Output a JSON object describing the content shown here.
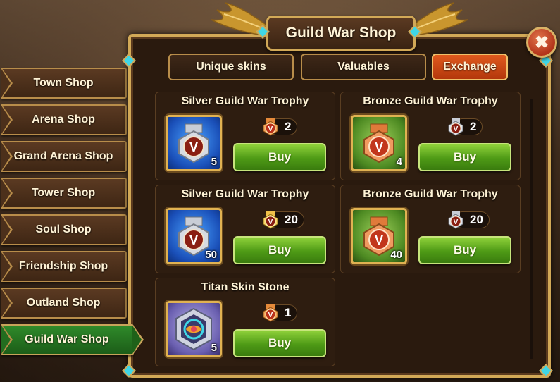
{
  "title": "Guild War Shop",
  "close_label": "✖",
  "side_tabs": [
    {
      "label": "Town Shop"
    },
    {
      "label": "Arena Shop"
    },
    {
      "label": "Grand Arena Shop"
    },
    {
      "label": "Tower Shop"
    },
    {
      "label": "Soul Shop"
    },
    {
      "label": "Friendship Shop"
    },
    {
      "label": "Outland Shop"
    },
    {
      "label": "Guild War Shop",
      "active": true
    }
  ],
  "top_tabs": [
    {
      "label": "Unique skins"
    },
    {
      "label": "Valuables"
    },
    {
      "label": "Exchange",
      "active": true
    }
  ],
  "items": [
    {
      "name": "Silver Guild War Trophy",
      "quantity": "5",
      "price": "2",
      "buy_label": "Buy",
      "icon": "silver-trophy-icon",
      "price_icon": "bronze-trophy-coin-icon"
    },
    {
      "name": "Bronze Guild War Trophy",
      "quantity": "4",
      "price": "2",
      "buy_label": "Buy",
      "icon": "bronze-trophy-icon",
      "price_icon": "silver-trophy-coin-icon"
    },
    {
      "name": "Silver Guild War Trophy",
      "quantity": "50",
      "price": "20",
      "buy_label": "Buy",
      "icon": "silver-trophy-icon",
      "price_icon": "gold-trophy-coin-icon"
    },
    {
      "name": "Bronze Guild War Trophy",
      "quantity": "40",
      "price": "20",
      "buy_label": "Buy",
      "icon": "bronze-trophy-icon",
      "price_icon": "silver-trophy-coin-icon"
    },
    {
      "name": "Titan Skin Stone",
      "quantity": "5",
      "price": "1",
      "buy_label": "Buy",
      "icon": "titan-skin-stone-icon",
      "price_icon": "bronze-trophy-coin-icon"
    }
  ],
  "colors": {
    "panel_border": "#d2a957",
    "active_side_tab": "#2f8a2a",
    "active_top_tab": "#e05a1e",
    "buy_button": "#4e9a16"
  }
}
